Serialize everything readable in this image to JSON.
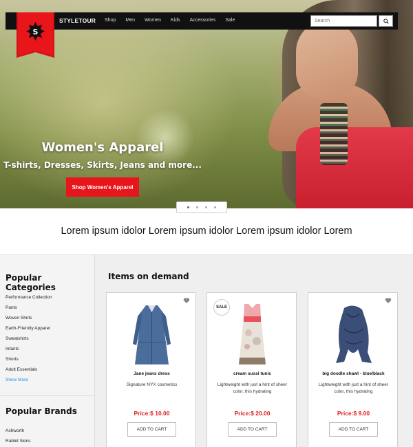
{
  "brand": {
    "logo_letter": "S",
    "name": "STYLETOUR",
    "accent_color": "#e8151b"
  },
  "nav": {
    "links": [
      "Shop",
      "Men",
      "Women",
      "Kids",
      "Accessories",
      "Sale"
    ],
    "search_placeholder": "Search",
    "search_icon": "search-icon"
  },
  "hero": {
    "title": "Women's Apparel",
    "subtitle": "T-shirts, Dresses, Skirts, Jeans and more...",
    "cta_label": "Shop Women's Apparel",
    "slide_count": 4,
    "active_slide": 1
  },
  "tagline": "Lorem ipsum idolor Lorem ipsum idolor Lorem ipsum idolor Lorem",
  "sidebar": {
    "categories_heading": "Popular Categories",
    "categories": [
      "Performance Collection",
      "Pants",
      "Woven Shirts",
      "Earth-Friendly Apparel",
      "Sweatshirts",
      "Infants",
      "Shorts",
      "Adult Essentials"
    ],
    "show_more": "Show More",
    "brands_heading": "Popular Brands",
    "brands": [
      "Ashworth",
      "Rabbit Skins"
    ]
  },
  "items": {
    "heading": "Items on demand",
    "sale_badge": "SALE",
    "cart_label": "ADD TO CART",
    "products": [
      {
        "name": "Jane jeans dress",
        "description": "Signature NYX cosmetics",
        "price": "Price:$ 10.00",
        "favorite_icon": "heart-icon",
        "sale": false
      },
      {
        "name": "cream sussi tunic",
        "description": "Lightweight with just a hint of sheer color, this hydrating",
        "price": "Price:$ 20.00",
        "favorite_icon": "",
        "sale": true
      },
      {
        "name": "big doodle shawl - blue/black",
        "description": "Lightweight with just a hint of sheer color, this hydrating",
        "price": "Price:$ 9.00",
        "favorite_icon": "heart-icon",
        "sale": false
      }
    ]
  }
}
